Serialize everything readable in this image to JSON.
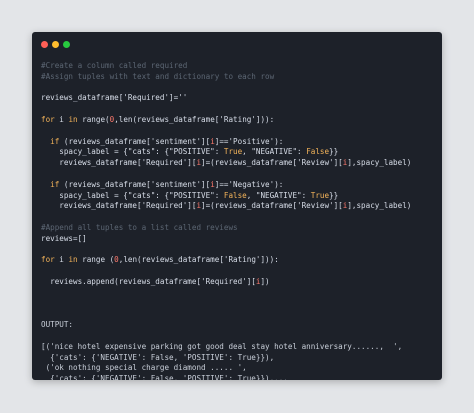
{
  "window": {
    "controls": [
      {
        "name": "close",
        "color": "#ff5f56"
      },
      {
        "name": "minimize",
        "color": "#ffbd2e"
      },
      {
        "name": "maximize",
        "color": "#27c93f"
      }
    ]
  },
  "code_lines": [
    {
      "text": "#Create a column called required",
      "kind": "comment"
    },
    {
      "text": "#Assign tuples with text and dictionary to each row",
      "kind": "comment"
    },
    {
      "text": "",
      "kind": "blank"
    },
    {
      "text": "reviews_dataframe['Required']=''",
      "kind": "code"
    },
    {
      "text": "",
      "kind": "blank"
    },
    {
      "text": "for i in range(0,len(reviews_dataframe['Rating'])):",
      "kind": "code"
    },
    {
      "text": "",
      "kind": "blank"
    },
    {
      "text": "  if (reviews_dataframe['sentiment'][i]=='Positive'):",
      "kind": "code"
    },
    {
      "text": "    spacy_label = {\"cats\": {\"POSITIVE\": True, \"NEGATIVE\": False}}",
      "kind": "code"
    },
    {
      "text": "    reviews_dataframe['Required'][i]=(reviews_dataframe['Review'][i],spacy_label)",
      "kind": "code"
    },
    {
      "text": "",
      "kind": "blank"
    },
    {
      "text": "  if (reviews_dataframe['sentiment'][i]=='Negative'):",
      "kind": "code"
    },
    {
      "text": "    spacy_label = {\"cats\": {\"POSITIVE\": False, \"NEGATIVE\": True}}",
      "kind": "code"
    },
    {
      "text": "    reviews_dataframe['Required'][i]=(reviews_dataframe['Review'][i],spacy_label)",
      "kind": "code"
    },
    {
      "text": "",
      "kind": "blank"
    },
    {
      "text": "#Append all tuples to a list called reviews",
      "kind": "comment"
    },
    {
      "text": "reviews=[]",
      "kind": "code"
    },
    {
      "text": "",
      "kind": "blank"
    },
    {
      "text": "for i in range (0,len(reviews_dataframe['Rating'])):",
      "kind": "code"
    },
    {
      "text": "",
      "kind": "blank"
    },
    {
      "text": "  reviews.append(reviews_dataframe['Required'][i])",
      "kind": "code"
    },
    {
      "text": "",
      "kind": "blank"
    },
    {
      "text": "",
      "kind": "blank"
    },
    {
      "text": "",
      "kind": "blank"
    },
    {
      "text": "OUTPUT:",
      "kind": "output"
    },
    {
      "text": "",
      "kind": "blank"
    },
    {
      "text": "[('nice hotel expensive parking got good deal stay hotel anniversary......,  ',",
      "kind": "output"
    },
    {
      "text": "  {'cats': {'NEGATIVE': False, 'POSITIVE': True}}),",
      "kind": "output"
    },
    {
      "text": " ('ok nothing special charge diamond ..... ',",
      "kind": "output"
    },
    {
      "text": "  {'cats': {'NEGATIVE': False, 'POSITIVE': True}}),...",
      "kind": "output"
    }
  ]
}
